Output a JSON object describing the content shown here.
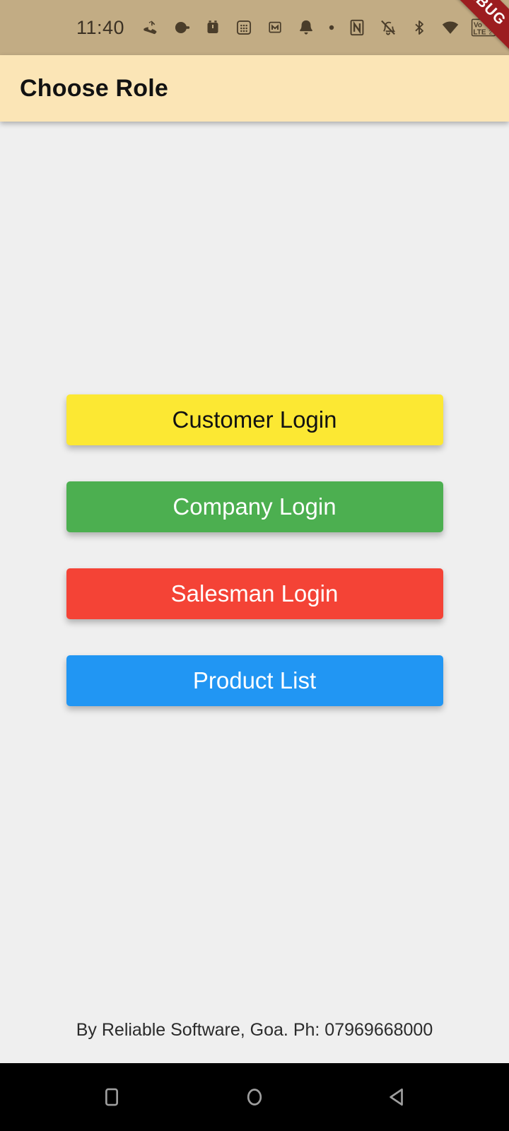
{
  "status_bar": {
    "clock": "11:40",
    "background_color": "#C2AC84",
    "icon_color": "#4A3D2A",
    "icons": [
      "missed-call-icon",
      "alarm-snooze-icon",
      "alarm-clock-icon",
      "calculator-icon",
      "m-app-icon",
      "notification-bell-icon",
      "dot-icon",
      "nfc-icon",
      "bell-muted-icon",
      "bluetooth-icon",
      "wifi-icon",
      "volte-icon",
      "signal-bars-sim1-icon",
      "signal-bars-sim2-icon",
      "sim-alert-icon"
    ],
    "volte_label_top": "Vo",
    "volte_label_bottom": "LTE",
    "volte_sim1": "1",
    "volte_sim2": "2"
  },
  "debug_ribbon": {
    "label": "DEBUG",
    "background_color": "#9C1D20",
    "text_color": "#FFFFFF"
  },
  "app_bar": {
    "title": "Choose Role",
    "background_color": "#FBE5B6",
    "title_color": "#121212"
  },
  "page": {
    "background_color": "#EFEFEF"
  },
  "buttons": [
    {
      "label": "Customer Login",
      "background_color": "#FCE833",
      "text_color": "#121212",
      "name": "customer-login-button"
    },
    {
      "label": "Company Login",
      "background_color": "#4CAF50",
      "text_color": "#FFFFFF",
      "name": "company-login-button"
    },
    {
      "label": "Salesman Login",
      "background_color": "#F44336",
      "text_color": "#FFFFFF",
      "name": "salesman-login-button"
    },
    {
      "label": "Product List",
      "background_color": "#2196F3",
      "text_color": "#FFFFFF",
      "name": "product-list-button"
    }
  ],
  "footer": {
    "text": "By Reliable Software, Goa. Ph: 07969668000",
    "text_color": "#2B2B2B"
  },
  "nav_bar": {
    "background_color": "#000000",
    "icon_color": "#9E9E9E",
    "items": [
      {
        "name": "recents-button",
        "icon": "square-icon"
      },
      {
        "name": "home-button",
        "icon": "circle-icon"
      },
      {
        "name": "back-button",
        "icon": "triangle-left-icon"
      }
    ]
  }
}
